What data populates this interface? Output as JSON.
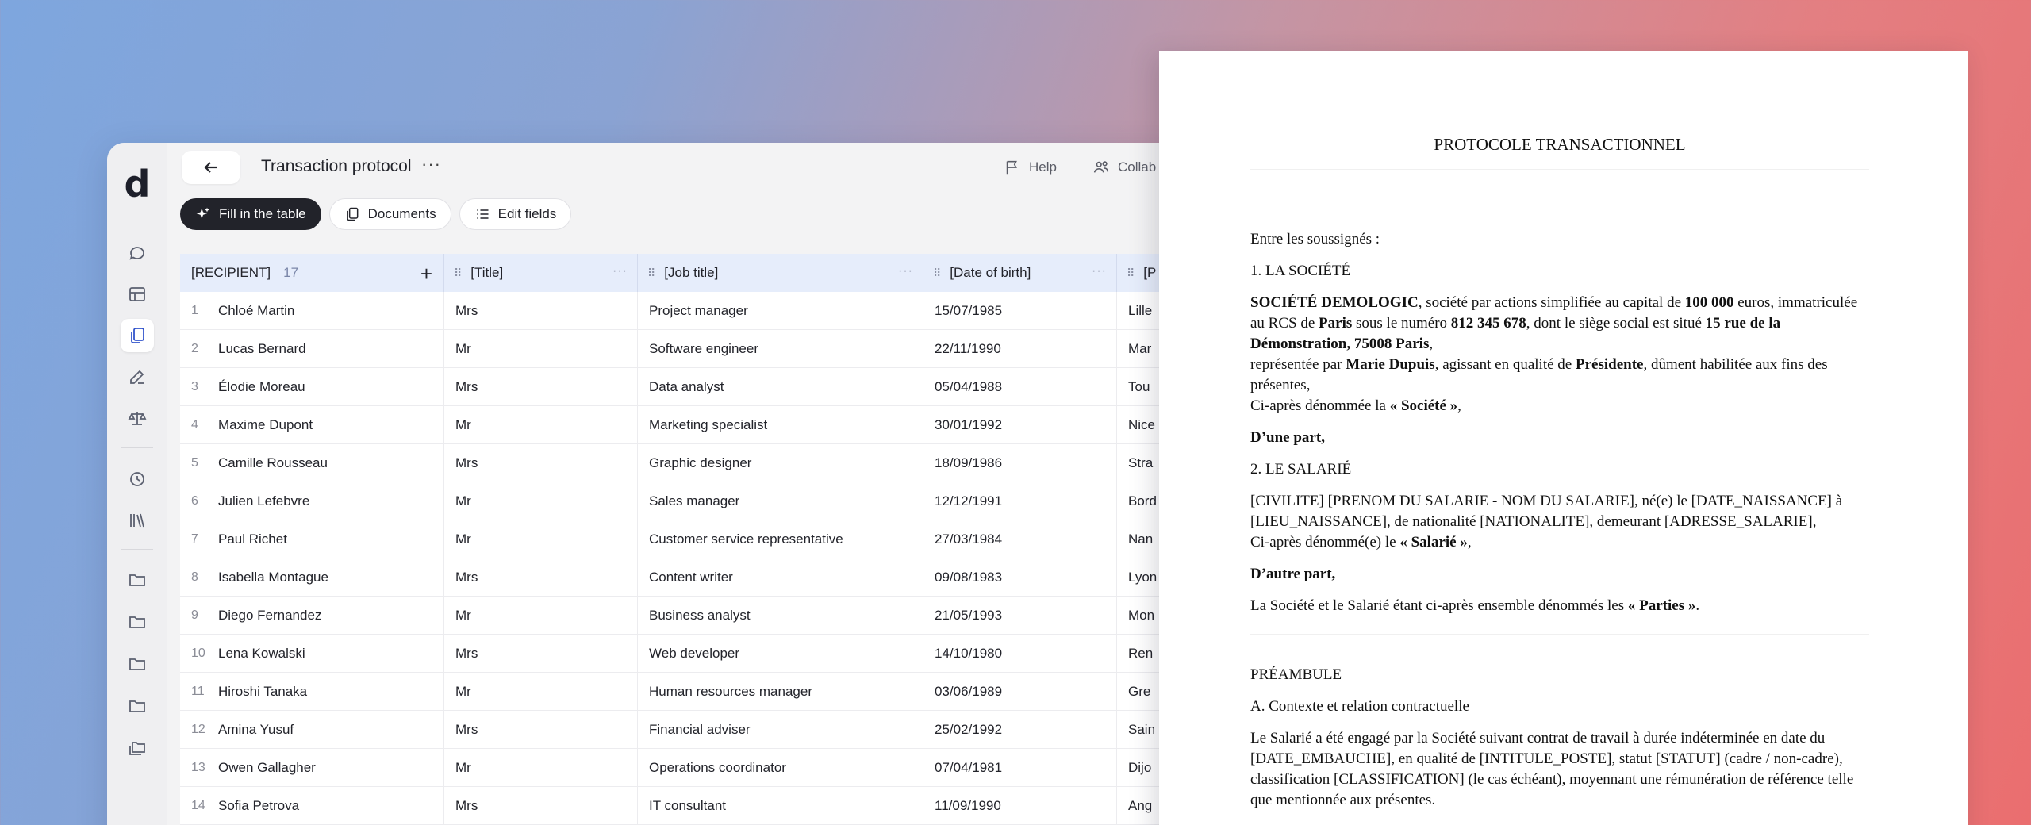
{
  "app": {
    "logo": "d",
    "title": "Transaction protocol",
    "more": "···",
    "help_label": "Help",
    "collab_label": "Collab"
  },
  "rail": {
    "items": [
      "chat-icon",
      "table-icon",
      "documents-icon",
      "edit-icon",
      "scale-icon",
      "history-icon",
      "library-icon",
      "folder-icon",
      "folder-icon",
      "folder-icon",
      "folder-icon",
      "folders-icon"
    ],
    "active": "documents-icon"
  },
  "toolbar": {
    "fill_label": "Fill in the table",
    "documents_label": "Documents",
    "edit_fields_label": "Edit fields"
  },
  "table": {
    "headers": {
      "recipient": "[RECIPIENT]",
      "recipient_count": "17",
      "title": "[Title]",
      "job": "[Job title]",
      "dob": "[Date of birth]",
      "place": "[P"
    },
    "rows": [
      {
        "n": "1",
        "name": "Chloé Martin",
        "title": "Mrs",
        "job": "Project manager",
        "dob": "15/07/1985",
        "place": "Lille"
      },
      {
        "n": "2",
        "name": "Lucas Bernard",
        "title": "Mr",
        "job": "Software engineer",
        "dob": "22/11/1990",
        "place": "Mar"
      },
      {
        "n": "3",
        "name": "Élodie Moreau",
        "title": "Mrs",
        "job": "Data analyst",
        "dob": "05/04/1988",
        "place": "Tou"
      },
      {
        "n": "4",
        "name": "Maxime Dupont",
        "title": "Mr",
        "job": "Marketing specialist",
        "dob": "30/01/1992",
        "place": "Nice"
      },
      {
        "n": "5",
        "name": "Camille Rousseau",
        "title": "Mrs",
        "job": "Graphic designer",
        "dob": "18/09/1986",
        "place": "Stra"
      },
      {
        "n": "6",
        "name": "Julien Lefebvre",
        "title": "Mr",
        "job": "Sales manager",
        "dob": "12/12/1991",
        "place": "Bord"
      },
      {
        "n": "7",
        "name": "Paul Richet",
        "title": "Mr",
        "job": "Customer service representative",
        "dob": "27/03/1984",
        "place": "Nan"
      },
      {
        "n": "8",
        "name": "Isabella Montague",
        "title": "Mrs",
        "job": "Content writer",
        "dob": "09/08/1983",
        "place": "Lyon"
      },
      {
        "n": "9",
        "name": "Diego Fernandez",
        "title": "Mr",
        "job": "Business analyst",
        "dob": "21/05/1993",
        "place": "Mon"
      },
      {
        "n": "10",
        "name": "Lena Kowalski",
        "title": "Mrs",
        "job": "Web developer",
        "dob": "14/10/1980",
        "place": "Ren"
      },
      {
        "n": "11",
        "name": "Hiroshi Tanaka",
        "title": "Mr",
        "job": "Human resources manager",
        "dob": "03/06/1989",
        "place": "Gre"
      },
      {
        "n": "12",
        "name": "Amina Yusuf",
        "title": "Mrs",
        "job": "Financial adviser",
        "dob": "25/02/1992",
        "place": "Sain"
      },
      {
        "n": "13",
        "name": "Owen Gallagher",
        "title": "Mr",
        "job": "Operations coordinator",
        "dob": "07/04/1981",
        "place": "Dijo"
      },
      {
        "n": "14",
        "name": "Sofia Petrova",
        "title": "Mrs",
        "job": "IT consultant",
        "dob": "11/09/1990",
        "place": "Ang"
      }
    ]
  },
  "doc": {
    "title": "PROTOCOLE TRANSACTIONNEL",
    "intro": "Entre les soussignés :",
    "s1": "1. LA SOCIÉTÉ",
    "soc_name": "SOCIÉTÉ DEMOLOGIC",
    "soc_t1": ", société par actions simplifiée au capital de ",
    "soc_capital": "100 000",
    "soc_t2": " euros, immatriculée au RCS de ",
    "soc_city": "Paris",
    "soc_t3": " sous le numéro ",
    "soc_rcs": "812 345 678",
    "soc_t4": ", dont le siège social est situé ",
    "soc_addr": "15 rue de la Démonstration, 75008 Paris",
    "soc_t5": ",",
    "rep_t1": "représentée par ",
    "rep_name": "Marie Dupuis",
    "rep_t2": ", agissant en qualité de ",
    "rep_role": "Présidente",
    "rep_t3": ", dûment habilitée aux fins des présentes,",
    "soc_alias_t": "Ci-après dénommée la ",
    "soc_alias": "« Société »",
    "soc_alias_end": ",",
    "dune": "D’une part,",
    "s2": "2. LE SALARIÉ",
    "sal_f1": "[CIVILITE] [PRENOM DU SALARIE - NOM DU SALARIE]",
    "sal_t1": ", né(e) le ",
    "sal_f2": "[DATE_NAISSANCE]",
    "sal_t2": " à ",
    "sal_f3": "[LIEU_NAISSANCE]",
    "sal_t3": ", de nationalité ",
    "sal_f4": "[NATIONALITE]",
    "sal_t4": ", demeurant ",
    "sal_f5": "[ADRESSE_SALARIE]",
    "sal_t5": ",",
    "sal_alias_t": "Ci-après dénommé(e) le ",
    "sal_alias": "« Salarié »",
    "sal_alias_end": ",",
    "dautre": "D’autre part,",
    "parties_t": "La Société et le Salarié étant ci-après ensemble dénommés les ",
    "parties": "« Parties »",
    "parties_end": ".",
    "preambule": "PRÉAMBULE",
    "sA": "A. Contexte et relation contractuelle",
    "ctx_t1": "Le Salarié a été engagé par la Société suivant contrat de travail à durée indéterminée en date du ",
    "ctx_f1": "[DATE_EMBAUCHE]",
    "ctx_t2": ", en qualité de ",
    "ctx_f2": "[INTITULE_POSTE]",
    "ctx_t3": ", statut ",
    "ctx_f3": "[STATUT]",
    "ctx_t4": " (cadre / non-cadre), classification ",
    "ctx_f4": "[CLASSIFICATION]",
    "ctx_t5": " (le cas échéant), moyennant une rémunération de référence telle que mentionnée aux présentes."
  }
}
